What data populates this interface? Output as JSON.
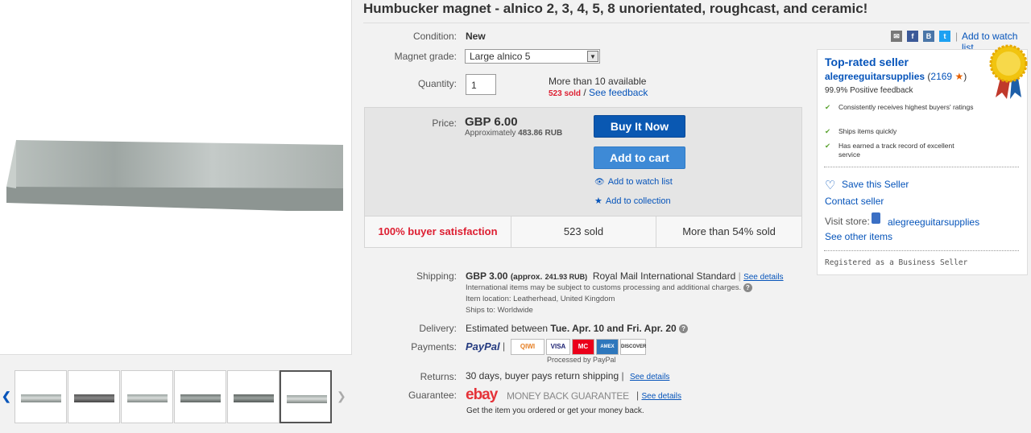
{
  "listing": {
    "title": "Humbucker magnet - alnico 2, 3, 4, 5, 8 unorientated, roughcast, and ceramic!"
  },
  "details": {
    "condition_label": "Condition:",
    "condition_value": "New",
    "grade_label": "Magnet grade:",
    "grade_value": "Large alnico 5",
    "quantity_label": "Quantity:",
    "quantity_value": "1",
    "available": "More than 10 available",
    "sold": "523 sold",
    "sep": " / ",
    "feedback_link": "See feedback"
  },
  "price": {
    "label": "Price:",
    "value": "GBP 6.00",
    "approx_prefix": "Approximately",
    "approx_value": "483.86 RUB",
    "buy_now": "Buy It Now",
    "add_to_cart": "Add to cart",
    "add_watch": "Add to watch list",
    "add_collection": "Add to collection"
  },
  "stats": {
    "satisfaction": "100% buyer satisfaction",
    "sold": "523 sold",
    "percent_sold": "More than 54% sold"
  },
  "shipping": {
    "label": "Shipping:",
    "price": "GBP 3.00",
    "approx": "(approx.",
    "approx_rub": "241.93 RUB)",
    "service": "Royal Mail International Standard",
    "see_details": "See details",
    "intl_note": "International items may be subject to customs processing and additional charges.",
    "location_label": "Item location:",
    "location": "Leatherhead, United Kingdom",
    "ships_to_label": "Ships to:",
    "ships_to": "Worldwide"
  },
  "delivery": {
    "label": "Delivery:",
    "prefix": "Estimated between",
    "dates": "Tue. Apr. 10 and Fri. Apr. 20"
  },
  "payments": {
    "label": "Payments:",
    "paypal": "PayPal",
    "logos": [
      "QIWI",
      "VISA",
      "MC",
      "AMEX",
      "DISCOVER"
    ],
    "processed": "Processed by PayPal"
  },
  "returns": {
    "label": "Returns:",
    "text": "30 days, buyer pays return shipping",
    "see_details": "See details"
  },
  "guarantee": {
    "label": "Guarantee:",
    "ebay": "ebay",
    "mbg": "MONEY BACK GUARANTEE",
    "see_details": "See details",
    "sub": "Get the item you ordered or get your money back."
  },
  "share": {
    "add_watch": "Add to watch list"
  },
  "seller": {
    "top_rated": "Top-rated seller",
    "name": "alegreeguitarsupplies",
    "score": "2169",
    "positive": "99.9% Positive feedback",
    "bullets": [
      "Consistently receives highest buyers' ratings",
      "Ships items quickly",
      "Has earned a track record of excellent service"
    ],
    "save": "Save this Seller",
    "contact": "Contact seller",
    "visit_label": "Visit store:",
    "store": "alegreeguitarsupplies",
    "other": "See other items",
    "registered": "Registered as a Business Seller"
  },
  "colors": {
    "link": "#0654ba",
    "buy_button": "#0a58b2",
    "cart_button": "#3e8ad6",
    "sold_red": "#dd1e31",
    "star": "#e66000"
  }
}
